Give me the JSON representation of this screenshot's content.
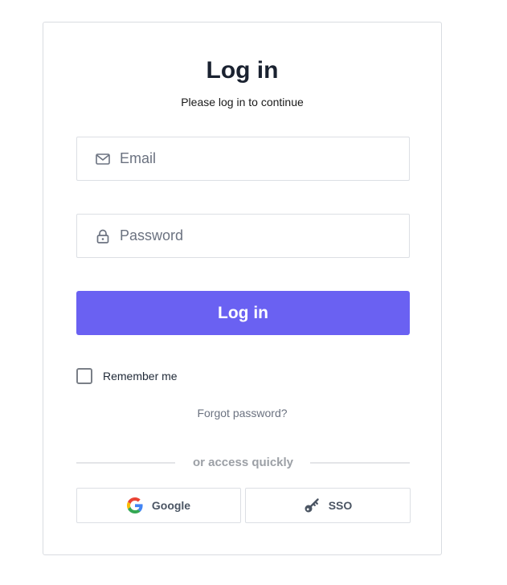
{
  "header": {
    "title": "Log in",
    "subtitle": "Please log in to continue"
  },
  "form": {
    "email": {
      "placeholder": "Email",
      "value": "",
      "icon": "envelope-icon"
    },
    "password": {
      "placeholder": "Password",
      "value": "",
      "icon": "lock-icon"
    },
    "submit_label": "Log in",
    "remember_label": "Remember me",
    "remember_checked": false,
    "forgot_label": "Forgot password?"
  },
  "quick_access": {
    "divider_label": "or access quickly",
    "buttons": [
      {
        "label": "Google",
        "icon": "google-icon"
      },
      {
        "label": "SSO",
        "icon": "key-icon"
      }
    ]
  },
  "colors": {
    "primary": "#6a61f2",
    "title": "#1a2230",
    "muted": "#6b7280",
    "border": "#dcdfe4"
  }
}
